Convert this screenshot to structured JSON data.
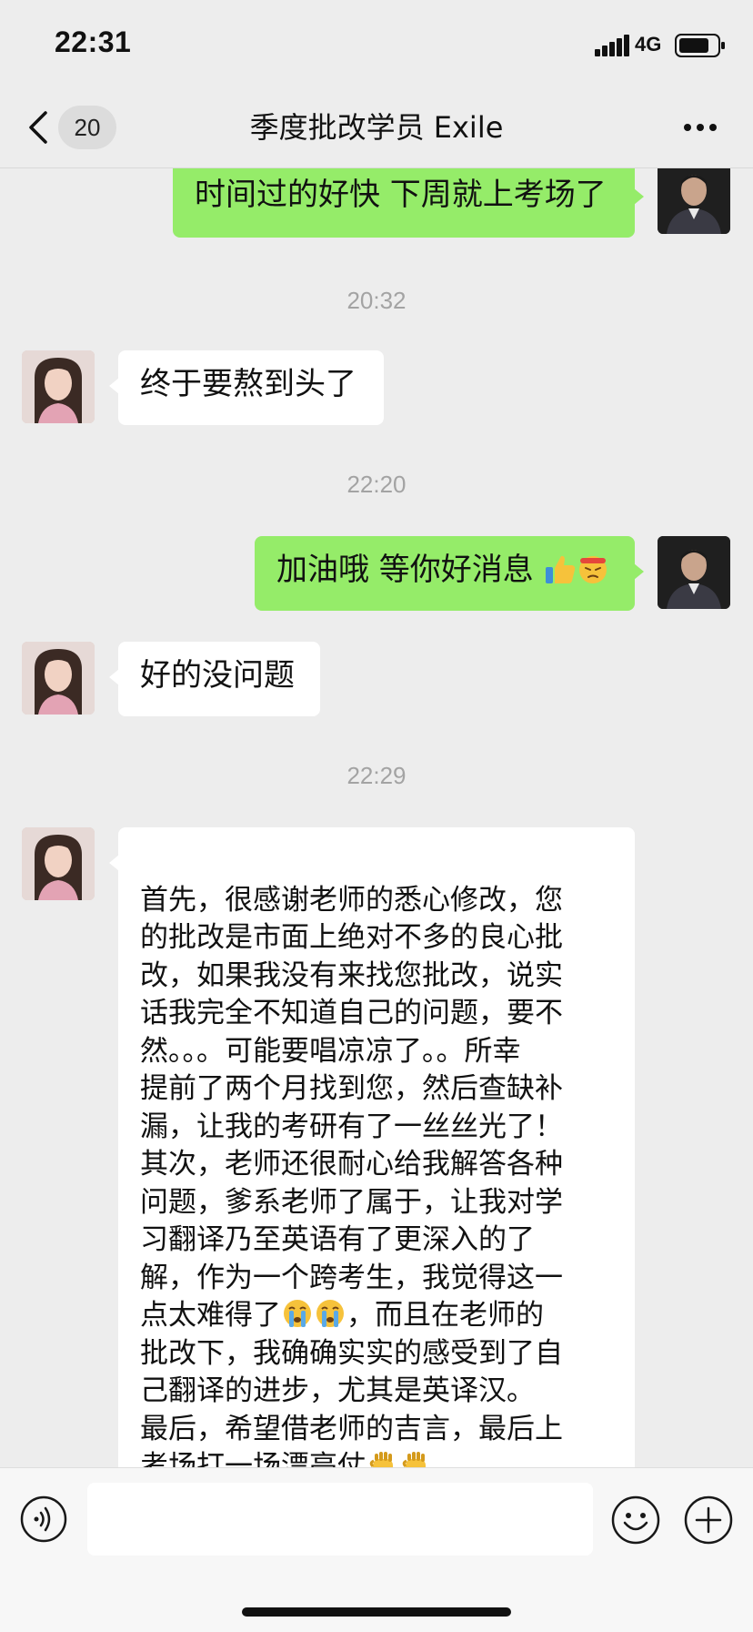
{
  "status_bar": {
    "time": "22:31",
    "network": "4G",
    "signal_icon": "cellular-signal-icon",
    "battery_icon": "battery-icon"
  },
  "nav": {
    "back_icon": "chevron-left-icon",
    "unread_count": "20",
    "title": "季度批改学员 Exile",
    "more_icon": "more-dots-icon"
  },
  "messages": [
    {
      "sender": "me",
      "text": "时间过的好快 下周就上考场了"
    },
    {
      "type": "time",
      "text": "20:32"
    },
    {
      "sender": "peer",
      "text": "终于要熬到头了"
    },
    {
      "type": "time",
      "text": "22:20"
    },
    {
      "sender": "me",
      "text": "加油哦 等你好消息",
      "emojis": [
        "thumbs-up-icon",
        "determined-face-icon"
      ]
    },
    {
      "sender": "peer",
      "text": "好的没问题"
    },
    {
      "type": "time",
      "text": "22:29"
    },
    {
      "sender": "peer",
      "parts": {
        "p1": "首先，很感谢老师的悉心修改，您\n的批改是市面上绝对不多的良心批\n改，如果我没有来找您批改，说实\n话我完全不知道自己的问题，要不\n然。。。可能要唱凉凉了。。所幸\n提前了两个月找到您，然后查缺补\n漏，让我的考研有了一丝丝光了！\n其次，老师还很耐心给我解答各种\n问题，爹系老师了属于，让我对学\n习翻译乃至英语有了更深入的了\n解，作为一个跨考生，我觉得这一\n点太难得了",
        "p2": "，而且在老师的\n批改下，我确确实实的感受到了自\n己翻译的进步，尤其是英译汉。\n最后，希望借老师的吉言，最后上\n考场打一场漂亮仗",
        "emojis_a": [
          "crying-face-icon",
          "crying-face-icon"
        ],
        "emojis_b": [
          "raised-fist-icon",
          "raised-fist-icon"
        ]
      }
    }
  ],
  "input_bar": {
    "voice_icon": "voice-icon",
    "emoji_icon": "smiley-icon",
    "plus_icon": "plus-circle-icon"
  },
  "colors": {
    "my_bubble": "#95ec69",
    "peer_bubble": "#ffffff",
    "background": "#ededed"
  }
}
